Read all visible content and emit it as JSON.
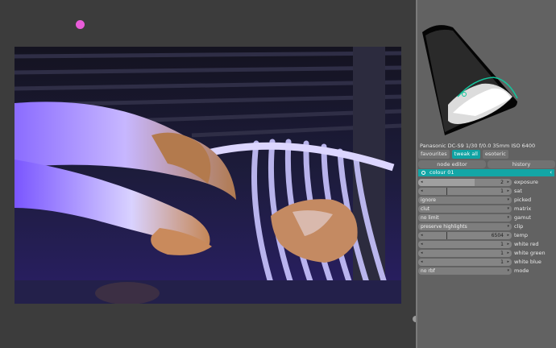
{
  "camera_info": "Panasonic DC-S9 1/30 f/0.0 35mm ISO 6400",
  "tabs": [
    {
      "label": "favourites"
    },
    {
      "label": "tweak all"
    },
    {
      "label": "esoteric"
    }
  ],
  "buttons": {
    "node_editor": "node editor",
    "history": "history"
  },
  "module": {
    "title": "colour 01",
    "collapse_glyph": "‹"
  },
  "params": {
    "exposure": {
      "label": "exposure",
      "value": "2",
      "fraction": 0.6
    },
    "sat": {
      "label": "sat",
      "value": "1",
      "fraction": 0.3
    },
    "picked": {
      "label": "picked",
      "value": "ignore"
    },
    "matrix": {
      "label": "matrix",
      "value": "clut"
    },
    "gamut": {
      "label": "gamut",
      "value": "no limit"
    },
    "clip": {
      "label": "clip",
      "value": "preserve highlights"
    },
    "temp": {
      "label": "temp",
      "value": "6504",
      "fraction": 0.3
    },
    "white_red": {
      "label": "white red",
      "value": "1"
    },
    "white_green": {
      "label": "white green",
      "value": "1"
    },
    "white_blue": {
      "label": "white blue",
      "value": "1"
    },
    "mode": {
      "label": "mode",
      "value": "no rbf"
    }
  },
  "colors": {
    "accent": "#13a6a6",
    "panel_bg": "#626262",
    "canvas_bg": "#3c3c3c",
    "pink_marker": "#e95cd9"
  },
  "icons": {
    "arrow_left": "◂",
    "arrow_right": "▸",
    "combo_arrow": "▾"
  }
}
